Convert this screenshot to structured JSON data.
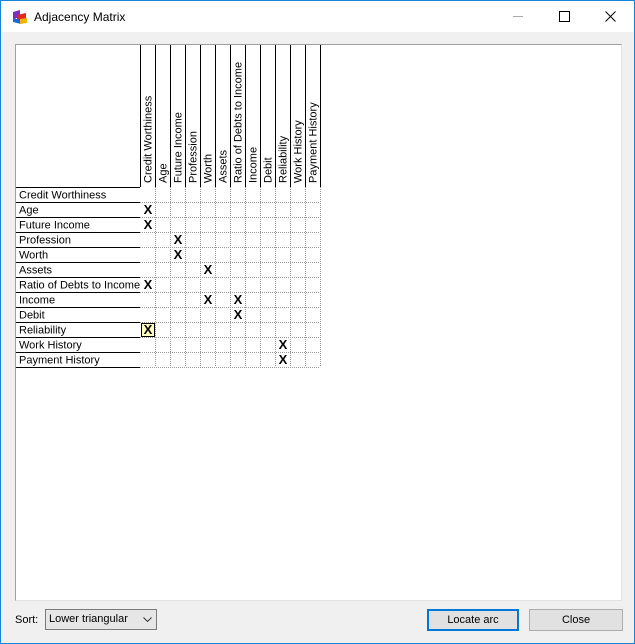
{
  "window": {
    "title": "Adjacency Matrix",
    "controls": [
      "minimize",
      "maximize",
      "close"
    ],
    "accent_color": "#1883d7"
  },
  "matrix": {
    "columns": [
      "Credit Worthiness",
      "Age",
      "Future Income",
      "Profession",
      "Worth",
      "Assets",
      "Ratio of Debts to Income",
      "Income",
      "Debit",
      "Reliability",
      "Work History",
      "Payment History"
    ],
    "rows": [
      "Credit Worthiness",
      "Age",
      "Future Income",
      "Profession",
      "Worth",
      "Assets",
      "Ratio of Debts to Income",
      "Income",
      "Debit",
      "Reliability",
      "Work History",
      "Payment History"
    ],
    "mark": "X",
    "arcs": [
      {
        "row": "Age",
        "col": "Credit Worthiness"
      },
      {
        "row": "Future Income",
        "col": "Credit Worthiness"
      },
      {
        "row": "Profession",
        "col": "Future Income"
      },
      {
        "row": "Worth",
        "col": "Future Income"
      },
      {
        "row": "Assets",
        "col": "Worth"
      },
      {
        "row": "Ratio of Debts to Income",
        "col": "Credit Worthiness"
      },
      {
        "row": "Income",
        "col": "Worth"
      },
      {
        "row": "Income",
        "col": "Ratio of Debts to Income"
      },
      {
        "row": "Debit",
        "col": "Ratio of Debts to Income"
      },
      {
        "row": "Reliability",
        "col": "Credit Worthiness",
        "selected": true
      },
      {
        "row": "Work History",
        "col": "Reliability"
      },
      {
        "row": "Payment History",
        "col": "Reliability"
      }
    ],
    "selected_fill": "#ffffc0"
  },
  "footer": {
    "sort_label": "Sort:",
    "sort_value": "Lower triangular",
    "locate_button": "Locate arc",
    "close_button": "Close"
  }
}
